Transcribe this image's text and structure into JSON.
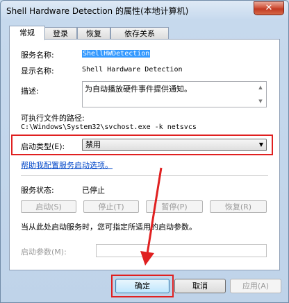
{
  "window": {
    "title": "Shell Hardware Detection 的属性(本地计算机)",
    "close_label": "✕"
  },
  "tabs": [
    {
      "label": "常规",
      "active": true
    },
    {
      "label": "登录",
      "active": false
    },
    {
      "label": "恢复",
      "active": false
    },
    {
      "label": "依存关系",
      "active": false
    }
  ],
  "general": {
    "service_name_label": "服务名称:",
    "service_name_value": "ShellHWDetection",
    "display_name_label": "显示名称:",
    "display_name_value": "Shell Hardware Detection",
    "description_label": "描述:",
    "description_value": "为自动播放硬件事件提供通知。",
    "exe_path_label": "可执行文件的路径:",
    "exe_path_value": "C:\\Windows\\System32\\svchost.exe -k netsvcs",
    "startup_type_label": "启动类型(E):",
    "startup_type_value": "禁用",
    "help_link": "帮助我配置服务启动选项。",
    "service_status_label": "服务状态:",
    "service_status_value": "已停止",
    "start_button": "启动(S)",
    "stop_button": "停止(T)",
    "pause_button": "暂停(P)",
    "resume_button": "恢复(R)",
    "hint_text": "当从此处启动服务时，您可指定所适用的启动参数。",
    "start_params_label": "启动参数(M):",
    "start_params_value": ""
  },
  "footer": {
    "ok_button": "确定",
    "cancel_button": "取消",
    "apply_button": "应用(A)"
  },
  "colors": {
    "highlight_red": "#e02020",
    "selection_blue": "#3399ff",
    "link_blue": "#0046c8"
  },
  "icons": {
    "dropdown": "chevron-down-icon",
    "close": "close-icon",
    "annotation": "red-arrow-icon"
  }
}
